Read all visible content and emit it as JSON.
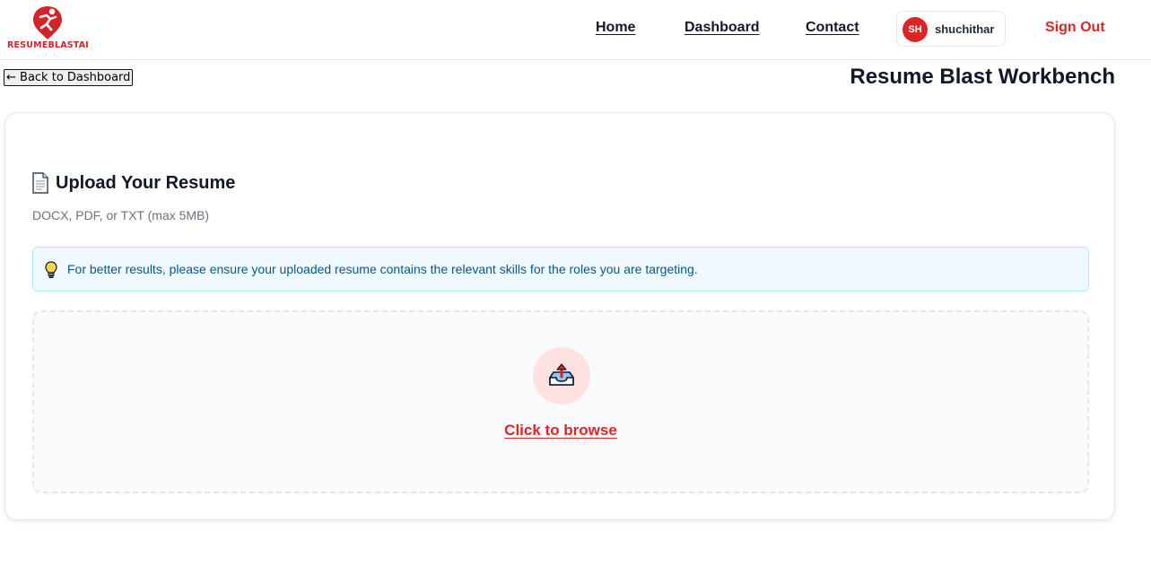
{
  "header": {
    "logo_text": "RESUMEBLASTAI",
    "nav": {
      "home": "Home",
      "dashboard": "Dashboard",
      "contact": "Contact"
    },
    "user": {
      "initials": "SH",
      "name": "shuchithar"
    },
    "sign_out": "Sign Out"
  },
  "subheader": {
    "back_label": "← Back to Dashboard",
    "page_title": "Resume Blast Workbench"
  },
  "upload": {
    "title": "Upload Your Resume",
    "subtitle": "DOCX, PDF, or TXT (max 5MB)",
    "tip": "For better results, please ensure your uploaded resume contains the relevant skills for the roles you are targeting.",
    "browse_label": "Click to browse"
  },
  "icons": {
    "logo": "runner-pin-logo",
    "document": "document-icon",
    "tip": "lightbulb-icon",
    "upload": "inbox-upload-icon"
  },
  "colors": {
    "brand_red": "#dc2626",
    "tip_bg": "#f0f9ff",
    "tip_text": "#075985",
    "upload_circle": "#fee2e2"
  }
}
